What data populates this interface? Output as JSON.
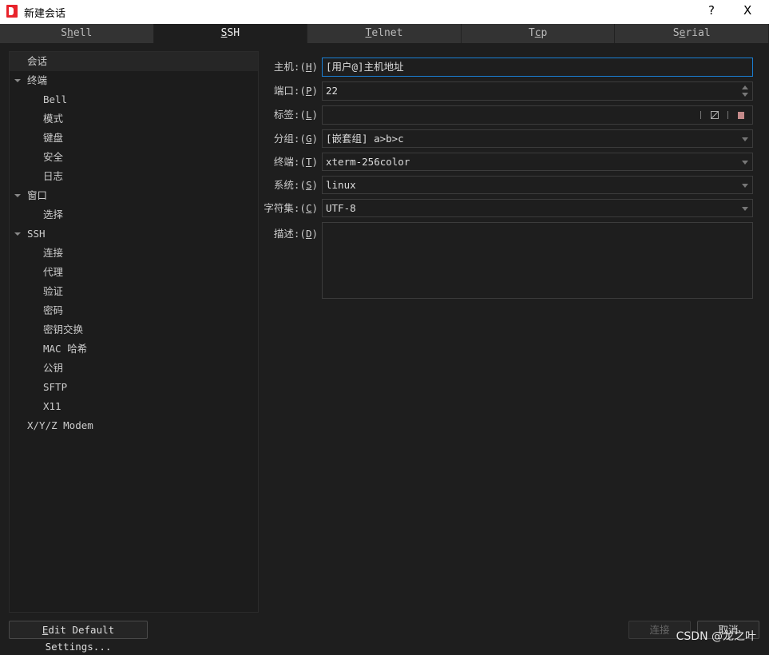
{
  "window": {
    "title": "新建会话",
    "help": "?",
    "close": "X"
  },
  "tabs": [
    {
      "pre": "S",
      "key": "h",
      "post": "ell",
      "active": false
    },
    {
      "pre": "",
      "key": "S",
      "post": "SH",
      "active": true
    },
    {
      "pre": "",
      "key": "T",
      "post": "elnet",
      "active": false
    },
    {
      "pre": "T",
      "key": "c",
      "post": "p",
      "active": false
    },
    {
      "pre": "S",
      "key": "e",
      "post": "rial",
      "active": false
    }
  ],
  "tree": [
    {
      "label": "会话",
      "level": 0,
      "selected": true,
      "expandable": false
    },
    {
      "label": "终端",
      "level": 0,
      "expandable": true
    },
    {
      "label": "Bell",
      "level": 1
    },
    {
      "label": "模式",
      "level": 1
    },
    {
      "label": "键盘",
      "level": 1
    },
    {
      "label": "安全",
      "level": 1
    },
    {
      "label": "日志",
      "level": 1
    },
    {
      "label": "窗口",
      "level": 0,
      "expandable": true
    },
    {
      "label": "选择",
      "level": 1
    },
    {
      "label": "SSH",
      "level": 0,
      "expandable": true
    },
    {
      "label": "连接",
      "level": 1
    },
    {
      "label": "代理",
      "level": 1
    },
    {
      "label": "验证",
      "level": 1
    },
    {
      "label": "密码",
      "level": 1
    },
    {
      "label": "密钥交换",
      "level": 1
    },
    {
      "label": "MAC 哈希",
      "level": 1
    },
    {
      "label": "公钥",
      "level": 1
    },
    {
      "label": "SFTP",
      "level": 1
    },
    {
      "label": "X11",
      "level": 1
    },
    {
      "label": "X/Y/Z Modem",
      "level": 0,
      "expandable": false
    }
  ],
  "form": {
    "host": {
      "pre": "主机:(",
      "key": "H",
      "post": ")",
      "value": "[用户@]主机地址"
    },
    "port": {
      "pre": "端口:(",
      "key": "P",
      "post": ")",
      "value": "22"
    },
    "label": {
      "pre": "标签:(",
      "key": "L",
      "post": ")",
      "value": ""
    },
    "group": {
      "pre": "分组:(",
      "key": "G",
      "post": ")",
      "value": "[嵌套组] a>b>c"
    },
    "terminal": {
      "pre": "终端:(",
      "key": "T",
      "post": ")",
      "value": "xterm-256color"
    },
    "system": {
      "pre": "系统:(",
      "key": "S",
      "post": ")",
      "value": "linux"
    },
    "charset": {
      "pre": "字符集:(",
      "key": "C",
      "post": ")",
      "value": "UTF-8"
    },
    "desc": {
      "pre": "描述:(",
      "key": "D",
      "post": ")",
      "value": ""
    },
    "label_color": "#c48a8a"
  },
  "buttons": {
    "edit_key": "E",
    "edit_rest": "dit Default Settings...",
    "connect": "连接",
    "cancel": "取消"
  },
  "watermark": "CSDN @龙之叶"
}
